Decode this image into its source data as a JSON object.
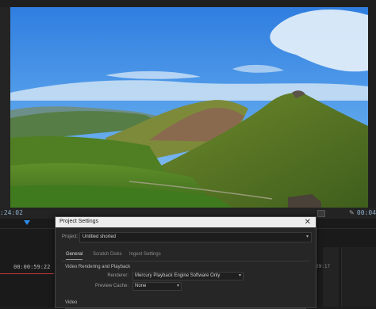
{
  "timecodes": {
    "left": ":24:02",
    "right": "00:04",
    "timeline_current": "00:00:59:22",
    "timeline_right": "29:17"
  },
  "dialog": {
    "title": "Project Settings",
    "close_glyph": "✕",
    "project_label": "Project:",
    "project_value": "Untitled shorted",
    "tabs": [
      {
        "label": "General",
        "active": true
      },
      {
        "label": "Scratch Disks",
        "active": false
      },
      {
        "label": "Ingest Settings",
        "active": false
      }
    ],
    "sections": {
      "video_rendering": "Video Rendering and Playback",
      "video": "Video"
    },
    "fields": {
      "renderer_label": "Renderer:",
      "renderer_value": "Mercury Playback Engine Software Only",
      "preview_cache_label": "Preview Cache:",
      "preview_cache_value": "None"
    }
  },
  "icons": {
    "wrench": "wrench-icon",
    "dropdown": "chevron-down-icon",
    "close": "close-icon",
    "playhead": "playhead-icon"
  },
  "colors": {
    "accent": "#2d8ceb",
    "playhead_line": "#c8363a",
    "timecode": "#8fb0cc"
  }
}
